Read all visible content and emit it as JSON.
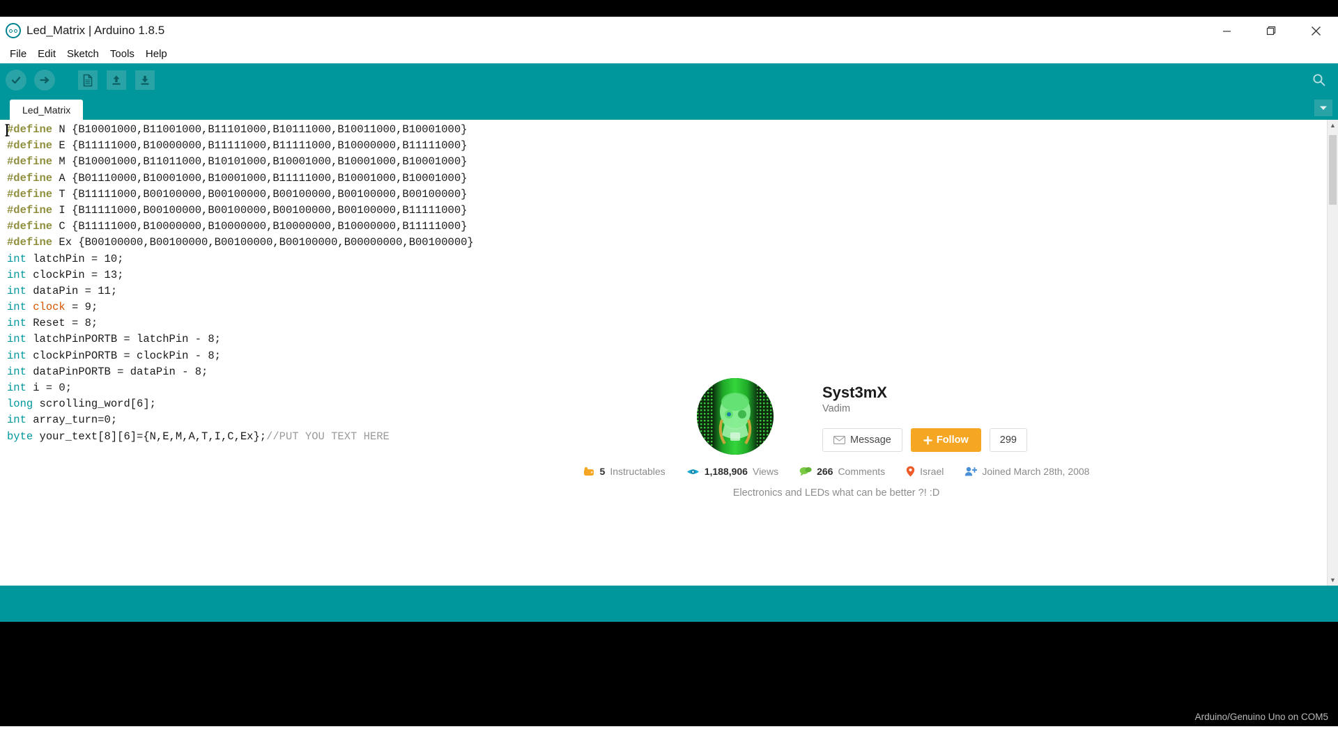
{
  "window": {
    "title": "Led_Matrix | Arduino 1.8.5",
    "logo_icon": "arduino-infinity-icon",
    "controls": {
      "minimize": "—",
      "maximize": "❐",
      "close": "✕"
    }
  },
  "menu": {
    "items": [
      {
        "label": "File"
      },
      {
        "label": "Edit"
      },
      {
        "label": "Sketch"
      },
      {
        "label": "Tools"
      },
      {
        "label": "Help"
      }
    ]
  },
  "toolbar": {
    "verify_label": "Verify",
    "upload_label": "Upload",
    "new_label": "New",
    "open_label": "Open",
    "save_label": "Save",
    "serial_monitor_label": "Serial Monitor"
  },
  "tabs": {
    "active": "Led_Matrix",
    "items": [
      {
        "label": "Led_Matrix"
      }
    ],
    "menu_icon": "chevron-down-icon"
  },
  "editor": {
    "lines": [
      {
        "tokens": [
          {
            "t": "#define ",
            "c": "k-pre"
          },
          {
            "t": "N {B10001000,B11001000,B11101000,B10111000,B10011000,B10001000}",
            "c": "k-txt"
          }
        ]
      },
      {
        "tokens": [
          {
            "t": "#define ",
            "c": "k-pre"
          },
          {
            "t": "E {B11111000,B10000000,B11111000,B11111000,B10000000,B11111000}",
            "c": "k-txt"
          }
        ]
      },
      {
        "tokens": [
          {
            "t": "#define ",
            "c": "k-pre"
          },
          {
            "t": "M {B10001000,B11011000,B10101000,B10001000,B10001000,B10001000}",
            "c": "k-txt"
          }
        ]
      },
      {
        "tokens": [
          {
            "t": "#define ",
            "c": "k-pre"
          },
          {
            "t": "A {B01110000,B10001000,B10001000,B11111000,B10001000,B10001000}",
            "c": "k-txt"
          }
        ]
      },
      {
        "tokens": [
          {
            "t": "#define ",
            "c": "k-pre"
          },
          {
            "t": "T {B11111000,B00100000,B00100000,B00100000,B00100000,B00100000}",
            "c": "k-txt"
          }
        ]
      },
      {
        "tokens": [
          {
            "t": "#define ",
            "c": "k-pre"
          },
          {
            "t": "I {B11111000,B00100000,B00100000,B00100000,B00100000,B11111000}",
            "c": "k-txt"
          }
        ]
      },
      {
        "tokens": [
          {
            "t": "#define ",
            "c": "k-pre"
          },
          {
            "t": "C {B11111000,B10000000,B10000000,B10000000,B10000000,B11111000}",
            "c": "k-txt"
          }
        ]
      },
      {
        "tokens": [
          {
            "t": "#define ",
            "c": "k-pre"
          },
          {
            "t": "Ex {B00100000,B00100000,B00100000,B00100000,B00000000,B00100000}",
            "c": "k-txt"
          }
        ]
      },
      {
        "tokens": [
          {
            "t": "int",
            "c": "k-type"
          },
          {
            "t": " latchPin = 10;",
            "c": "k-txt"
          }
        ]
      },
      {
        "tokens": [
          {
            "t": "int",
            "c": "k-type"
          },
          {
            "t": " clockPin = 13;",
            "c": "k-txt"
          }
        ]
      },
      {
        "tokens": [
          {
            "t": "int",
            "c": "k-type"
          },
          {
            "t": " dataPin = 11;",
            "c": "k-txt"
          }
        ]
      },
      {
        "tokens": [
          {
            "t": "int",
            "c": "k-type"
          },
          {
            "t": " ",
            "c": "k-txt"
          },
          {
            "t": "clock",
            "c": "k-func"
          },
          {
            "t": " = 9;",
            "c": "k-txt"
          }
        ]
      },
      {
        "tokens": [
          {
            "t": "int",
            "c": "k-type"
          },
          {
            "t": " Reset = 8;",
            "c": "k-txt"
          }
        ]
      },
      {
        "tokens": [
          {
            "t": "int",
            "c": "k-type"
          },
          {
            "t": " latchPinPORTB = latchPin - 8;",
            "c": "k-txt"
          }
        ]
      },
      {
        "tokens": [
          {
            "t": "int",
            "c": "k-type"
          },
          {
            "t": " clockPinPORTB = clockPin - 8;",
            "c": "k-txt"
          }
        ]
      },
      {
        "tokens": [
          {
            "t": "int",
            "c": "k-type"
          },
          {
            "t": " dataPinPORTB = dataPin - 8;",
            "c": "k-txt"
          }
        ]
      },
      {
        "tokens": [
          {
            "t": "int",
            "c": "k-type"
          },
          {
            "t": " i = 0;",
            "c": "k-txt"
          }
        ]
      },
      {
        "tokens": [
          {
            "t": "long",
            "c": "k-type"
          },
          {
            "t": " scrolling_word[6];",
            "c": "k-txt"
          }
        ]
      },
      {
        "tokens": [
          {
            "t": "int",
            "c": "k-type"
          },
          {
            "t": " array_turn=0;",
            "c": "k-txt"
          }
        ]
      },
      {
        "tokens": [
          {
            "t": "byte",
            "c": "k-type"
          },
          {
            "t": " your_text[8][6]={N,E,M,A,T,I,C,Ex};",
            "c": "k-txt"
          },
          {
            "t": "//PUT YOU TEXT HERE",
            "c": "k-com"
          }
        ]
      }
    ]
  },
  "status": {
    "board_info": "Arduino/Genuino Uno on COM5"
  },
  "profile": {
    "avatar_icon": "gas-mask-avatar",
    "username": "Syst3mX",
    "realname": "Vadim",
    "message_button": "Message",
    "message_icon": "envelope-icon",
    "follow_button": "Follow",
    "follow_icon": "plus-icon",
    "follower_count": "299",
    "stats": [
      {
        "icon": "instructables-robot-icon",
        "value": "5",
        "label": "Instructables",
        "color": "#f5a623"
      },
      {
        "icon": "eye-icon",
        "value": "1,188,906",
        "label": "Views",
        "color": "#1ba9d4"
      },
      {
        "icon": "comment-icon",
        "value": "266",
        "label": "Comments",
        "color": "#7ac943"
      },
      {
        "icon": "location-pin-icon",
        "value": "",
        "label": "Israel",
        "color": "#f05a28"
      },
      {
        "icon": "person-add-icon",
        "value": "",
        "label": "Joined March 28th, 2008",
        "color": "#4a90d9"
      }
    ],
    "bio": "Electronics and LEDs what can be better ?! :D"
  },
  "colors": {
    "teal": "#00979c",
    "teal_light": "#2aa3a6",
    "orange": "#f5a623",
    "black": "#000000"
  }
}
